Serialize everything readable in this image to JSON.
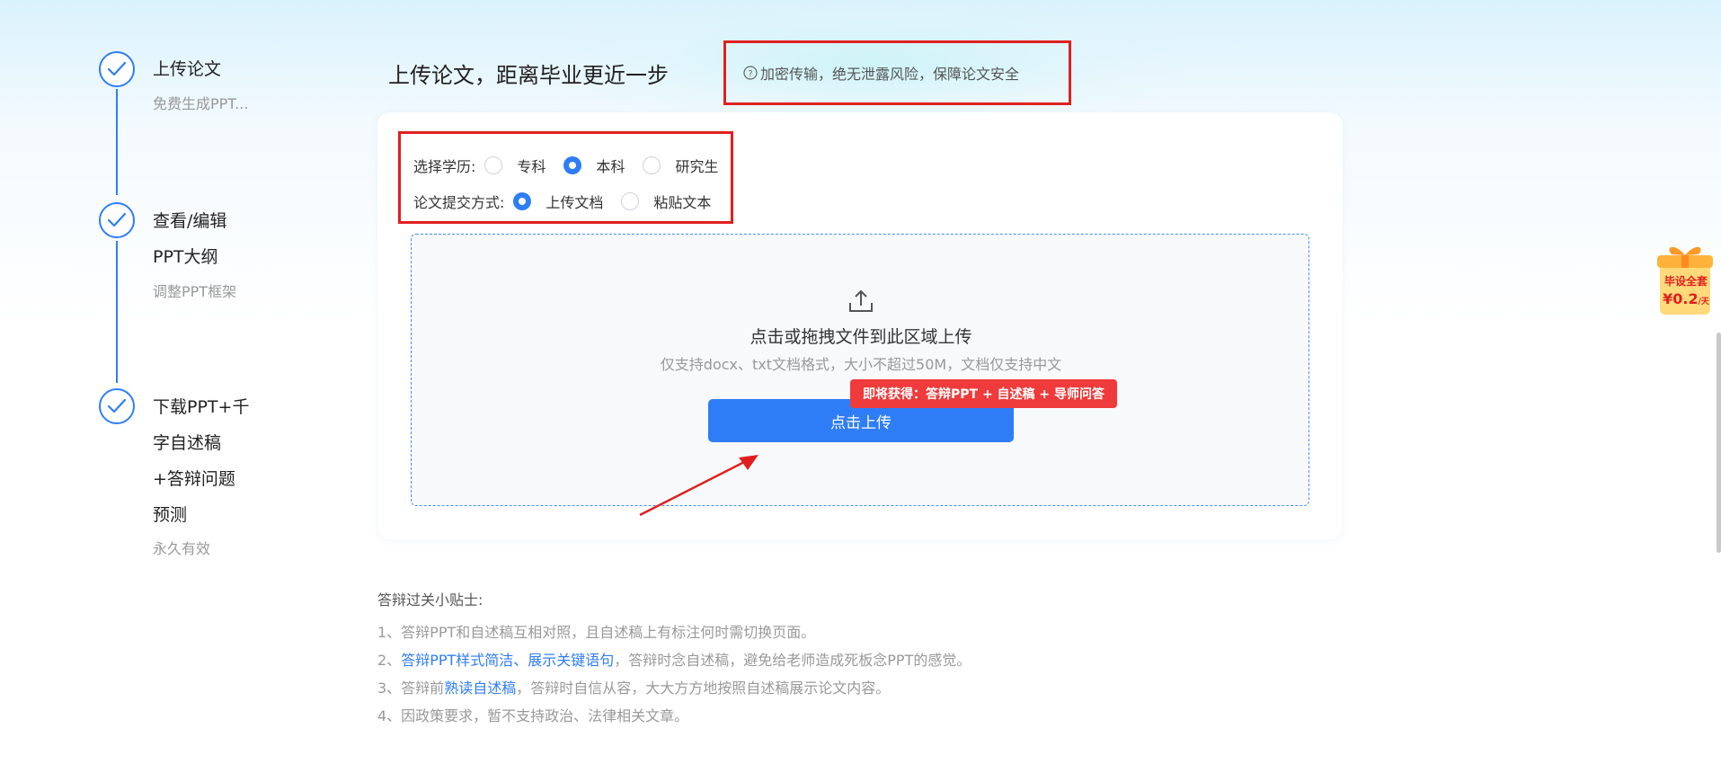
{
  "steps": [
    {
      "title_lines": [
        "上传论文"
      ],
      "subtitle": "免费生成PPT..."
    },
    {
      "title_lines": [
        "查看/编辑",
        "PPT大纲"
      ],
      "subtitle": "调整PPT框架"
    },
    {
      "title_lines": [
        "下载PPT+千",
        "字自述稿",
        "+答辩问题",
        "预测"
      ],
      "subtitle": "永久有效"
    }
  ],
  "header": {
    "title": "上传论文，距离毕业更近一步",
    "security_note": "加密传输，绝无泄露风险，保障论文安全"
  },
  "options": {
    "degree_label": "选择学历:",
    "degree_options": [
      "专科",
      "本科",
      "研究生"
    ],
    "degree_selected": "本科",
    "submit_label": "论文提交方式:",
    "submit_options": [
      "上传文档",
      "粘贴文本"
    ],
    "submit_selected": "上传文档"
  },
  "upload": {
    "title": "点击或拖拽文件到此区域上传",
    "hint": "仅支持docx、txt文档格式，大小不超过50M，文档仅支持中文",
    "button": "点击上传",
    "promo": "即将获得：答辩PPT + 自述稿 + 导师问答"
  },
  "tips": {
    "title": "答辩过关小贴士:",
    "tip1": "1、答辩PPT和自述稿互相对照，且自述稿上有标注何时需切换页面。",
    "tip2_prefix": "2、",
    "tip2_link": "答辩PPT样式简洁、展示关键语句",
    "tip2_suffix": "，答辩时念自述稿，避免给老师造成死板念PPT的感觉。",
    "tip3_prefix": "3、答辩前",
    "tip3_link": "熟读自述稿",
    "tip3_suffix": "，答辩时自信从容，大大方方地按照自述稿展示论文内容。",
    "tip4": "4、因政策要求，暂不支持政治、法律相关文章。"
  },
  "gift": {
    "line1": "毕设全套",
    "price": "¥0.2",
    "unit": "/天"
  },
  "colors": {
    "primary": "#2f7df6",
    "highlight_border": "#e02020",
    "promo_bg": "#ef3b3b"
  },
  "icons": [
    "check-icon",
    "info-icon",
    "upload-icon",
    "gift-icon"
  ]
}
